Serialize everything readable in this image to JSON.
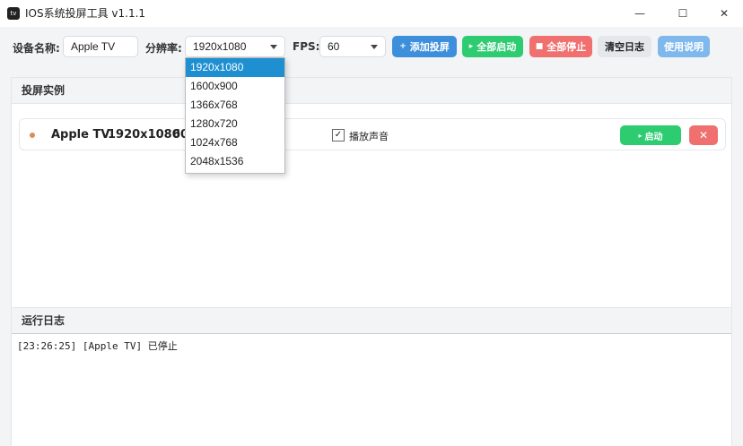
{
  "window": {
    "icon_text": "tv",
    "title": "IOS系统投屏工具 v1.1.1",
    "min_glyph": "—",
    "max_glyph": "☐",
    "close_glyph": "✕"
  },
  "toolbar": {
    "device_label": "设备名称:",
    "device_value": "Apple TV",
    "resolution_label": "分辨率:",
    "resolution_value": "1920x1080",
    "fps_label": "FPS:",
    "fps_value": "60",
    "add_label": "添加投屏",
    "add_icon": "+",
    "start_all_label": "全部启动",
    "start_all_icon": "▸",
    "stop_all_label": "全部停止",
    "stop_all_icon": "■",
    "clear_log_label": "清空日志",
    "help_label": "使用说明"
  },
  "instances_panel": {
    "title": "投屏实例",
    "instances": [
      {
        "name": "Apple TV",
        "resolution": "1920x1080",
        "fps": "60",
        "audio_label": "播放声音",
        "audio_checked": "✓",
        "start_label": "启动",
        "start_icon": "▸",
        "remove_icon": "✕"
      }
    ]
  },
  "log_panel": {
    "title": "运行日志",
    "lines": [
      "[23:26:25] [Apple TV] 已停止"
    ]
  },
  "resolution_dropdown": {
    "options": [
      "1920x1080",
      "1600x900",
      "1366x768",
      "1280x720",
      "1024x768",
      "2048x1536"
    ],
    "selected_index": 0
  },
  "colors": {
    "blue": "#3d8fdc",
    "green": "#2ecc71",
    "red": "#f07070",
    "status_dot": "#e08a5a",
    "dropdown_highlight": "#1e8fd1"
  }
}
